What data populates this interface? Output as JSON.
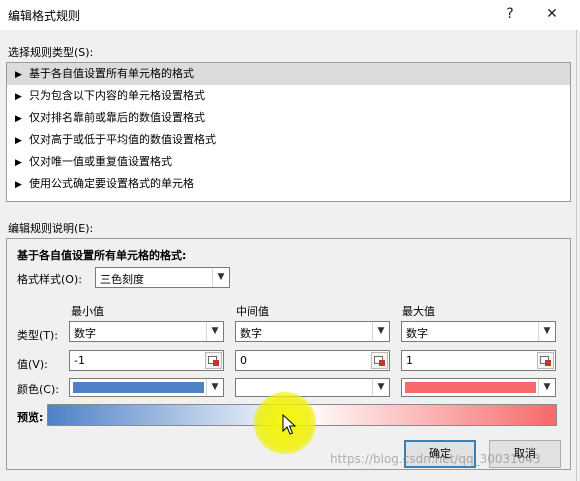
{
  "window": {
    "title": "编辑格式规则",
    "help_glyph": "?",
    "close_glyph": "✕"
  },
  "rule_type": {
    "label": "选择规则类型(S):",
    "items": [
      {
        "label": "基于各自值设置所有单元格的格式",
        "selected": true
      },
      {
        "label": "只为包含以下内容的单元格设置格式",
        "selected": false
      },
      {
        "label": "仅对排名靠前或靠后的数值设置格式",
        "selected": false
      },
      {
        "label": "仅对高于或低于平均值的数值设置格式",
        "selected": false
      },
      {
        "label": "仅对唯一值或重复值设置格式",
        "selected": false
      },
      {
        "label": "使用公式确定要设置格式的单元格",
        "selected": false
      }
    ],
    "arrow_glyph": "▶"
  },
  "description": {
    "label": "编辑规则说明(E):",
    "heading": "基于各自值设置所有单元格的格式:",
    "format_style_label": "格式样式(O):",
    "format_style_value": "三色刻度",
    "column_headers": {
      "min": "最小值",
      "mid": "中间值",
      "max": "最大值"
    },
    "row_labels": {
      "type": "类型(T):",
      "value": "值(V):",
      "color": "颜色(C):"
    },
    "types": {
      "min": "数字",
      "mid": "数字",
      "max": "数字"
    },
    "values": {
      "min": "-1",
      "mid": "0",
      "max": "1"
    },
    "colors": {
      "min": "#4f81c7",
      "mid": "#ffffff",
      "max": "#f8696b"
    },
    "preview_label": "预览:"
  },
  "buttons": {
    "ok": "确定",
    "cancel": "取消"
  },
  "watermark": "https://blog.csdn.net/qq_30031043"
}
